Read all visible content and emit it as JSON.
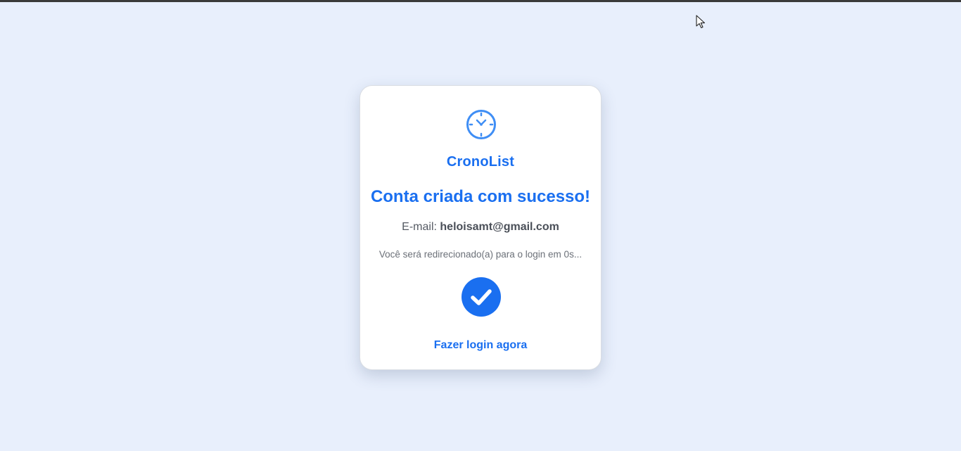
{
  "app": {
    "brand_name": "CronoList",
    "brand_icon": "clock-icon"
  },
  "success": {
    "headline": "Conta criada com sucesso!",
    "email_label": "E-mail:",
    "email_value": "heloisamt@gmail.com",
    "redirect_message": "Você será redirecionado(a) para o login em 0s...",
    "status_icon": "check-circle-icon",
    "login_link_label": "Fazer login agora"
  },
  "colors": {
    "accent": "#1a6ff0",
    "background": "#e8effc",
    "card": "#ffffff"
  }
}
